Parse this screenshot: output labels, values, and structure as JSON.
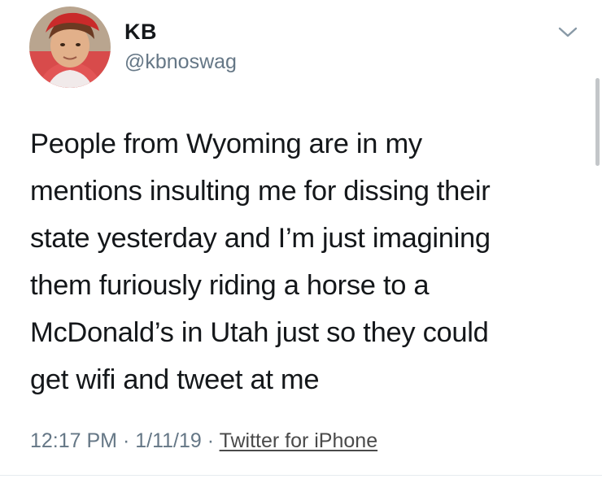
{
  "user": {
    "display_name": "KB",
    "handle": "@kbnoswag"
  },
  "tweet": {
    "lines": [
      "People from Wyoming are in my",
      "mentions insulting me for dissing their",
      "state yesterday and I’m just imagining",
      "them furiously riding a horse to a",
      "McDonald’s in Utah just so they could",
      "get wifi and tweet at me"
    ]
  },
  "meta": {
    "time": "12:17 PM",
    "separator1": " · ",
    "date": "1/11/19",
    "separator2": " · ",
    "source": "Twitter for iPhone"
  },
  "icons": {
    "menu": "chevron-down-icon"
  },
  "colors": {
    "text": "#14171a",
    "secondary": "#657786"
  }
}
